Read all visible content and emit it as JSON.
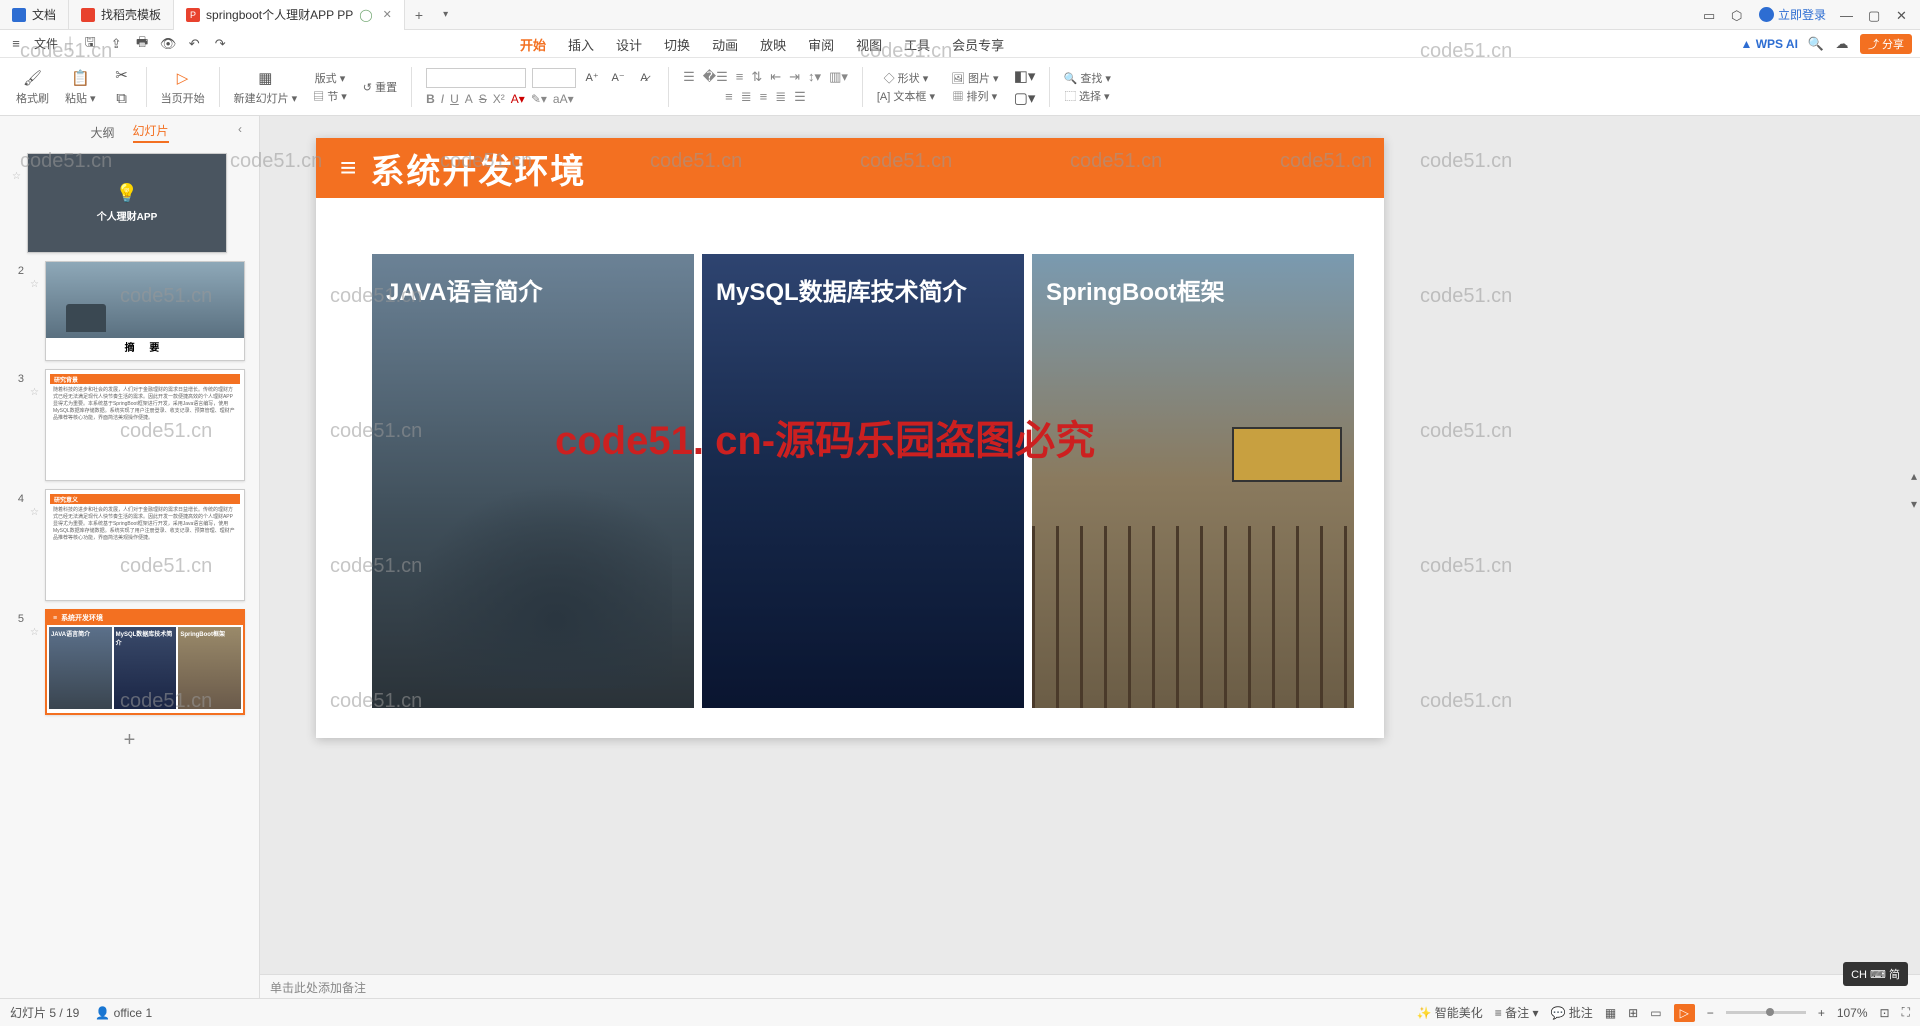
{
  "tabs": [
    {
      "label": "文档",
      "icon": "#2d6dd2"
    },
    {
      "label": "找稻壳模板",
      "icon": "#e8422e"
    },
    {
      "label": "springboot个人理财APP PP",
      "icon": "#e8422e",
      "active": true
    }
  ],
  "login": "立即登录",
  "qat": {
    "file": "文件"
  },
  "menu": [
    "开始",
    "插入",
    "设计",
    "切换",
    "动画",
    "放映",
    "审阅",
    "视图",
    "工具",
    "会员专享"
  ],
  "menu_active": 0,
  "wps_ai": "WPS AI",
  "share": "分享",
  "ribbon": {
    "format_painter": "格式刷",
    "paste": "粘贴",
    "current": "当页开始",
    "newslide": "新建幻灯片",
    "layout": "版式",
    "reset": "重置",
    "section": "节",
    "shape": "形状",
    "picture": "图片",
    "textbox": "文本框",
    "arrange": "排列",
    "find": "查找",
    "select": "选择"
  },
  "side": {
    "outline": "大纲",
    "slides": "幻灯片"
  },
  "thumbs": {
    "t1": "个人理财APP",
    "t2": "摘  要",
    "t3_bar": "研究背景",
    "t4_bar": "研究意义",
    "t5_bar": "系统开发环境",
    "t5_c1": "JAVA语言简介",
    "t5_c2": "MySQL数据库技术简介",
    "t5_c3": "SpringBoot框架",
    "lorem": "随着科技的进步和社会的发展，人们对于金融理财的需求日益增长。传统的理财方式已经无法满足现代人快节奏生活的需求。因此开发一款便捷高效的个人理财APP显得尤为重要。本系统基于SpringBoot框架进行开发，采用Java语言编写，使用MySQL数据库存储数据。系统实现了用户注册登录、收支记录、预算管理、理财产品推荐等核心功能，界面简洁美观操作便捷。"
  },
  "slide": {
    "title": "系统开发环境",
    "c1": "JAVA语言简介",
    "c2": "MySQL数据库技术简介",
    "c3": "SpringBoot框架"
  },
  "notes": "单击此处添加备注",
  "status": {
    "slide": "幻灯片 5 / 19",
    "office": "office 1",
    "beautify": "智能美化",
    "notes_btn": "备注",
    "comment": "批注",
    "zoom": "107%"
  },
  "ime": "CH ⌨ 简",
  "watermark": "code51.cn",
  "watermark_red": "code51. cn-源码乐园盗图必究"
}
